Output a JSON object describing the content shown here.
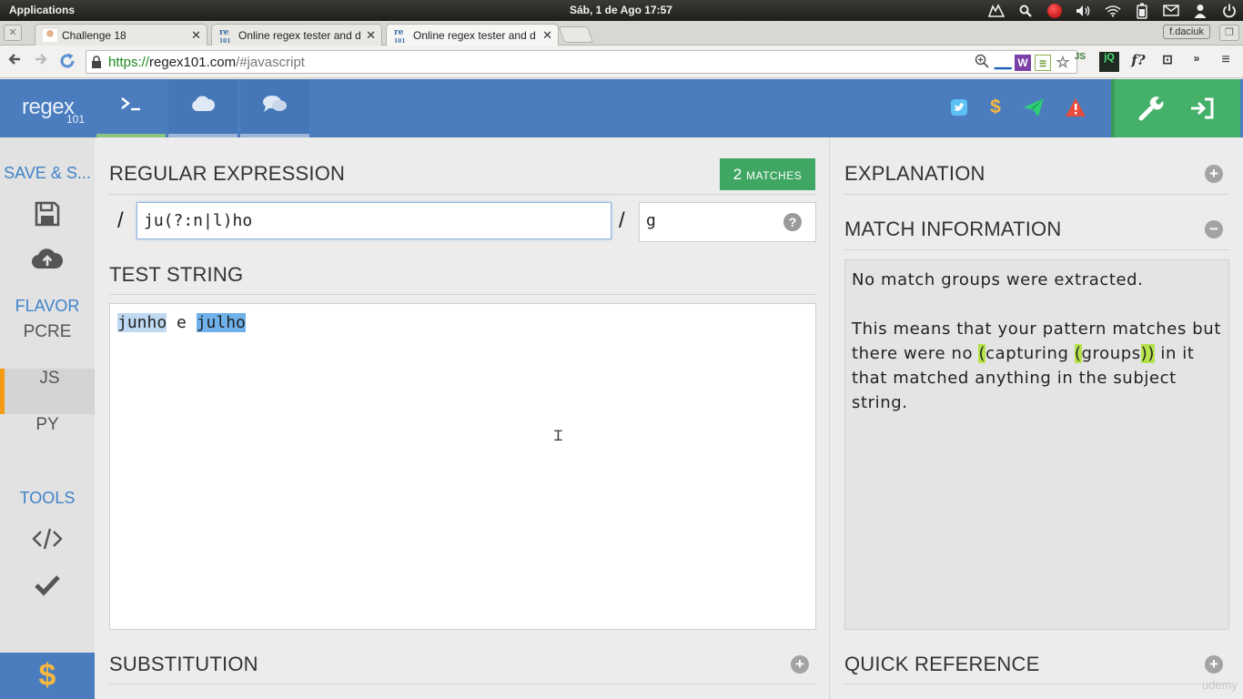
{
  "os": {
    "applications_label": "Applications",
    "clock": "Sáb,  1 de Ago 17:57"
  },
  "browser": {
    "tabs": [
      {
        "title": "Challenge 18",
        "favicon": "person-icon"
      },
      {
        "title": "Online regex tester and d",
        "favicon": "regex101-icon"
      },
      {
        "title": "Online regex tester and d",
        "favicon": "regex101-icon"
      }
    ],
    "active_tab": 2,
    "user_badge": "f.daciuk",
    "url_scheme": "https://",
    "url_host": "regex101.com",
    "url_path": "/#javascript",
    "extension_labels": [
      "W",
      "JS",
      "jQ",
      "f?"
    ]
  },
  "header": {
    "logo_text": "regex",
    "logo_number": "101",
    "nav_tabs": [
      {
        "id": "editor",
        "icon": "terminal-icon",
        "active": true
      },
      {
        "id": "library",
        "icon": "cloud-icon",
        "active": false
      },
      {
        "id": "chat",
        "icon": "chat-icon",
        "active": false
      }
    ],
    "action_icons": [
      "twitter-icon",
      "dollar-icon",
      "send-icon",
      "warning-icon"
    ],
    "tool_icons": [
      "wrench-icon",
      "sign-in-icon"
    ],
    "colors": {
      "header": "#4a7cbe",
      "tools": "#45b06a",
      "twitter": "#5cc0f3",
      "dollar": "#f5b840",
      "send": "#2fcf7a",
      "warning": "#e74c3c"
    }
  },
  "sidebar": {
    "save_heading": "SAVE & S...",
    "flavor_heading": "FLAVOR",
    "flavors": [
      "PCRE",
      "JS",
      "PY"
    ],
    "active_flavor": "JS",
    "tools_heading": "TOOLS",
    "accent": "#3f83c8"
  },
  "editor": {
    "regex_heading": "REGULAR EXPRESSION",
    "match_count": "2",
    "match_label": "MATCHES",
    "delimiter": "/",
    "regex": "ju(?:n|l)ho",
    "flags": "g",
    "flags_help": "?",
    "test_heading": "TEST STRING",
    "test_string": {
      "match1": "junho",
      "between": " e ",
      "match2": "julho"
    },
    "substitution_heading": "SUBSTITUTION"
  },
  "right_panel": {
    "explanation_heading": "EXPLANATION",
    "match_info_heading": "MATCH INFORMATION",
    "no_groups_text": "No match groups were extracted.",
    "explain_part1": "This means that your pattern matches but there were no ",
    "explain_paren": "(",
    "explain_capturing": "capturing ",
    "explain_groups_open": "(",
    "explain_groups": "groups",
    "explain_groups_close": ")",
    "explain_close": ")",
    "explain_part2": " in it that matched anything in the subject string.",
    "quick_ref_heading": "QUICK REFERENCE",
    "watermark": "udemy"
  }
}
